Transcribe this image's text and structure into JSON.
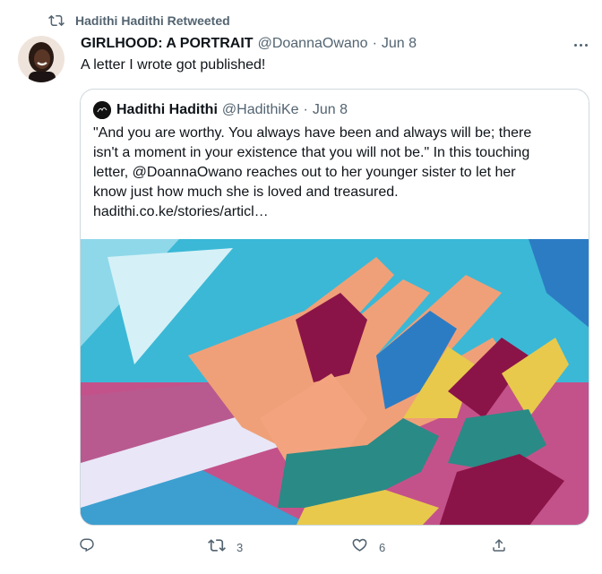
{
  "retweet": {
    "text": "Hadithi Hadithi Retweeted",
    "icon": "retweet-icon"
  },
  "tweet": {
    "author_name": "GIRLHOOD: A PORTRAIT",
    "author_handle": "@DoannaOwano",
    "separator": "·",
    "time": "Jun 8",
    "text": "A letter I wrote got published!",
    "avatar_icon": "avatar-photo"
  },
  "quote": {
    "author_name": "Hadithi Hadithi",
    "author_handle": "@HadithiKe",
    "separator": "·",
    "time": "Jun 8",
    "text_line1": "\"And you are worthy. You always have been and always will be; there",
    "text_line2": "isn't a moment in your existence that you will not be.\" In this touching",
    "text_line3": "letter, @DoannaOwano reaches out to her younger sister to let her",
    "text_line4": "know just how much she is loved and treasured.",
    "link": "hadithi.co.ke/stories/articl…",
    "media_icon": "hands-mural-image"
  },
  "actions": {
    "reply_icon": "reply-icon",
    "retweet_icon": "retweet-icon",
    "retweet_count": "3",
    "like_icon": "heart-icon",
    "like_count": "6",
    "share_icon": "share-icon"
  },
  "colors": {
    "text": "#0f1419",
    "secondary": "#536471",
    "border": "#cfd9de"
  }
}
